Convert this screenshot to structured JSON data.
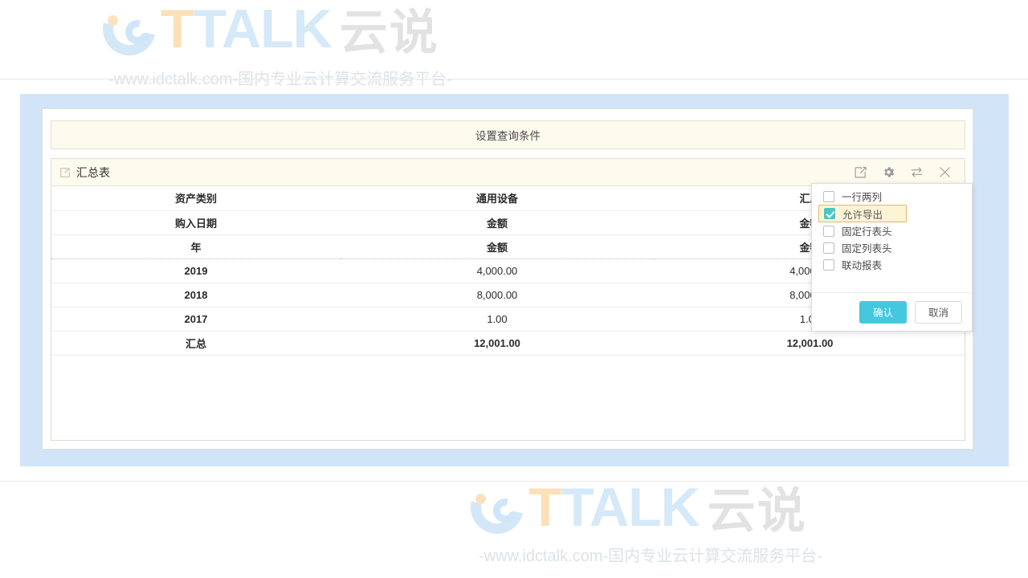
{
  "watermark": {
    "brand_talk": "TALK",
    "brand_cn": "云说",
    "tagline": "-www.idctalk.com-国内专业云计算交流服务平台-"
  },
  "query_bar": {
    "label": "设置查询条件"
  },
  "report": {
    "title": "汇总表",
    "tools": [
      {
        "name": "edit-icon",
        "label": "编辑"
      },
      {
        "name": "gear-icon",
        "label": "设置"
      },
      {
        "name": "swap-icon",
        "label": "行列互换"
      },
      {
        "name": "close-icon",
        "label": "关闭"
      }
    ],
    "header_rows": [
      {
        "c1": "资产类别",
        "c2": "通用设备",
        "c3": "汇总"
      },
      {
        "c1": "购入日期",
        "c2": "金额",
        "c3": "金额"
      },
      {
        "c1": "年",
        "c2": "金额",
        "c3": "金额"
      }
    ],
    "rows": [
      {
        "label": "2019",
        "v2": "4,000.00",
        "v3": "4,000.00"
      },
      {
        "label": "2018",
        "v2": "8,000.00",
        "v3": "8,000.00"
      },
      {
        "label": "2017",
        "v2": "1.00",
        "v3": "1.00"
      }
    ],
    "total": {
      "label": "汇总",
      "v2": "12,001.00",
      "v3": "12,001.00"
    }
  },
  "popup": {
    "options": [
      {
        "label": "一行两列",
        "checked": false
      },
      {
        "label": "允许导出",
        "checked": true
      },
      {
        "label": "固定行表头",
        "checked": false
      },
      {
        "label": "固定列表头",
        "checked": false
      },
      {
        "label": "联动报表",
        "checked": false
      }
    ],
    "confirm_label": "确认",
    "cancel_label": "取消"
  },
  "colors": {
    "accent_cyan": "#45c7e0",
    "check_teal": "#4ec5c1",
    "panel_blue": "#d2e5f8",
    "cream": "#fdfaee",
    "highlight_bg": "#fdf3d5",
    "highlight_border": "#e0bb62"
  }
}
